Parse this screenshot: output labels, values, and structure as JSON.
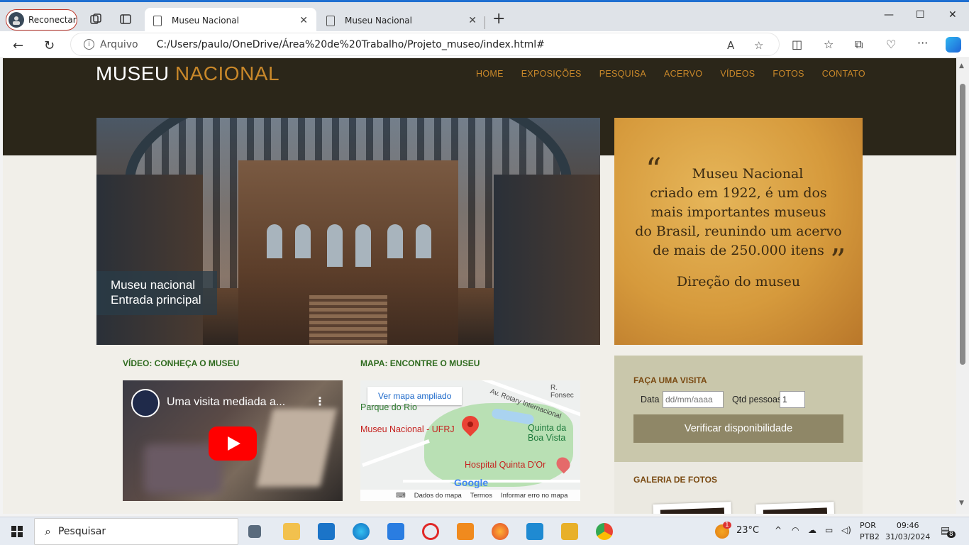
{
  "browser": {
    "profile_label": "Reconectar",
    "tabs": [
      {
        "title": "Museu Nacional",
        "active": true
      },
      {
        "title": "Museu Nacional",
        "active": false
      }
    ],
    "address": {
      "scheme_label": "Arquivo",
      "url": "C:/Users/paulo/OneDrive/Área%20de%20Trabalho/Projeto_museo/index.html#"
    }
  },
  "site": {
    "logo_part1": "MUSEU",
    "logo_part2": "NACIONAL",
    "menu": [
      "HOME",
      "EXPOSIÇÕES",
      "PESQUISA",
      "ACERVO",
      "VÍDEOS",
      "FOTOS",
      "CONTATO"
    ],
    "hero_caption_line1": "Museu nacional",
    "hero_caption_line2": "Entrada principal",
    "quote_lines": [
      "Museu Nacional",
      "criado em 1922, é um dos",
      "mais importantes museus",
      "do Brasil, reunindo um acervo",
      "de mais de 250.000 itens"
    ],
    "quote_author": "Direção do museu",
    "video_section_title": "VÍDEO: CONHEÇA O MUSEU",
    "video_title": "Uma visita mediada a...",
    "map_section_title": "MAPA: ENCONTRE O MUSEU",
    "map": {
      "button": "Ver mapa ampliado",
      "labels": {
        "park": "Parque do Rio",
        "street1": "Av. Rotary Internacional",
        "street2": "R. Fonsec",
        "museum": "Museu Nacional - UFRJ",
        "quinta1": "Quinta da",
        "quinta2": "Boa Vista",
        "hospital": "Hospital Quinta D'Or",
        "google": "Google"
      },
      "footer": [
        "Dados do mapa",
        "Termos",
        "Informar erro no mapa"
      ]
    },
    "visit": {
      "title": "FAÇA UMA VISITA",
      "date_label": "Data",
      "date_placeholder": "dd/mm/aaaa",
      "qty_label": "Qtd pessoas",
      "qty_value": "1",
      "button": "Verificar disponibilidade"
    },
    "gallery_title": "GALERIA DE FOTOS"
  },
  "taskbar": {
    "search_placeholder": "Pesquisar",
    "weather": "23°C",
    "lang1": "POR",
    "lang2": "PTB2",
    "time": "09:46",
    "date": "31/03/2024",
    "notifications": "8",
    "weather_badge": "1"
  },
  "colors": {
    "header_bg": "#2b2619",
    "accent": "#c9882a",
    "section_green": "#2f6b1f",
    "visit_bg": "#c9c7ab",
    "button_bg": "#8f8767"
  }
}
